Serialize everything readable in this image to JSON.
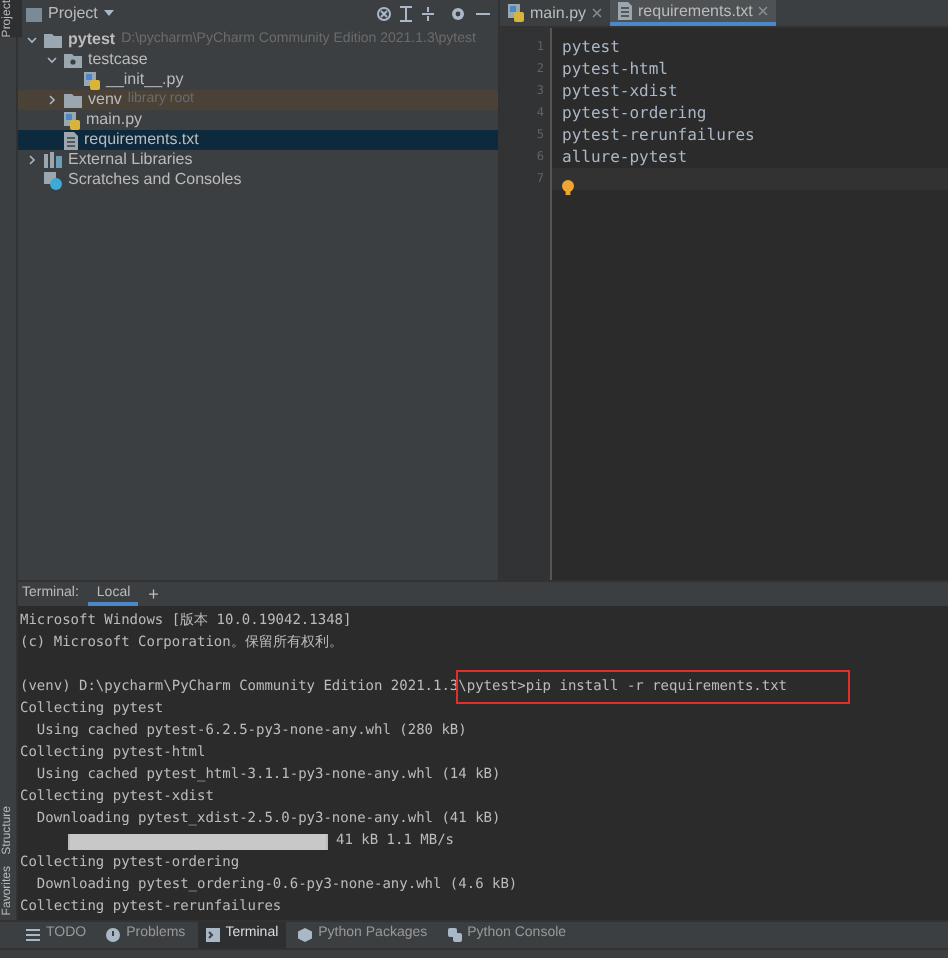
{
  "side_strip": {
    "top": [
      {
        "label": "Project",
        "selected": true
      }
    ],
    "bottom": [
      {
        "label": "Structure",
        "selected": false
      },
      {
        "label": "Favorites",
        "selected": false
      }
    ]
  },
  "project_panel": {
    "title": "Project",
    "tree": [
      {
        "name": "pytest",
        "hint": "D:\\pycharm\\PyCharm Community Edition 2021.1.3\\pytest",
        "kind": "folder",
        "expanded": true,
        "selected": false,
        "children": [
          {
            "name": "testcase",
            "kind": "package",
            "expanded": true,
            "selected": false,
            "children": [
              {
                "name": "__init__.py",
                "kind": "python",
                "selected": false
              }
            ]
          },
          {
            "name": "venv",
            "hint": "library root",
            "kind": "folder",
            "expanded": false,
            "selected": false,
            "excluded": true
          },
          {
            "name": "main.py",
            "kind": "python",
            "selected": false
          },
          {
            "name": "requirements.txt",
            "kind": "text",
            "selected": true
          }
        ]
      },
      {
        "name": "External Libraries",
        "kind": "library",
        "expanded": false,
        "selected": false
      },
      {
        "name": "Scratches and Consoles",
        "kind": "scratch",
        "selected": false
      }
    ]
  },
  "editor": {
    "tabs": [
      {
        "label": "main.py",
        "kind": "python",
        "selected": false
      },
      {
        "label": "requirements.txt",
        "kind": "text",
        "selected": true
      }
    ],
    "lines": [
      {
        "number": "1",
        "text": "pytest"
      },
      {
        "number": "2",
        "text": "pytest-html"
      },
      {
        "number": "3",
        "text": "pytest-xdist"
      },
      {
        "number": "4",
        "text": "pytest-ordering"
      },
      {
        "number": "5",
        "text": "pytest-rerunfailures"
      },
      {
        "number": "6",
        "text": "allure-pytest"
      },
      {
        "number": "7",
        "current": true
      }
    ]
  },
  "terminal": {
    "title": "Terminal:",
    "tabs": [
      {
        "label": "Local",
        "selected": true
      }
    ],
    "add": "+",
    "lines": [
      {
        "kind": "text",
        "text": "Microsoft Windows [版本 10.0.19042.1348]"
      },
      {
        "kind": "text",
        "text": "(c) Microsoft Corporation。保留所有权利。"
      },
      {
        "kind": "blank"
      },
      {
        "kind": "prompt",
        "prefix": "(venv) D:\\pycharm\\PyCharm Community Edition 2021.1.3",
        "command": "\\pytest>pip install -r requirements.txt"
      },
      {
        "kind": "text",
        "text": "Collecting pytest"
      },
      {
        "kind": "text",
        "text": "  Using cached pytest-6.2.5-py3-none-any.whl (280 kB)"
      },
      {
        "kind": "text",
        "text": "Collecting pytest-html"
      },
      {
        "kind": "text",
        "text": "  Using cached pytest_html-3.1.1-py3-none-any.whl (14 kB)"
      },
      {
        "kind": "text",
        "text": "Collecting pytest-xdist"
      },
      {
        "kind": "text",
        "text": "  Downloading pytest_xdist-2.5.0-py3-none-any.whl (41 kB)"
      },
      {
        "kind": "progress",
        "level": 1,
        "text": "41 kB 1.1 MB/s"
      },
      {
        "kind": "text",
        "text": "Collecting pytest-ordering"
      },
      {
        "kind": "text",
        "text": "  Downloading pytest_ordering-0.6-py3-none-any.whl (4.6 kB)"
      },
      {
        "kind": "text",
        "text": "Collecting pytest-rerunfailures"
      }
    ]
  },
  "bottom_toolbar": [
    {
      "label": "TODO",
      "kind": "todo",
      "selected": false
    },
    {
      "label": "Problems",
      "kind": "problems",
      "selected": false
    },
    {
      "label": "Terminal",
      "kind": "terminal",
      "selected": true
    },
    {
      "label": "Python Packages",
      "kind": "packages",
      "selected": false
    },
    {
      "label": "Python Console",
      "kind": "console",
      "selected": false
    }
  ]
}
